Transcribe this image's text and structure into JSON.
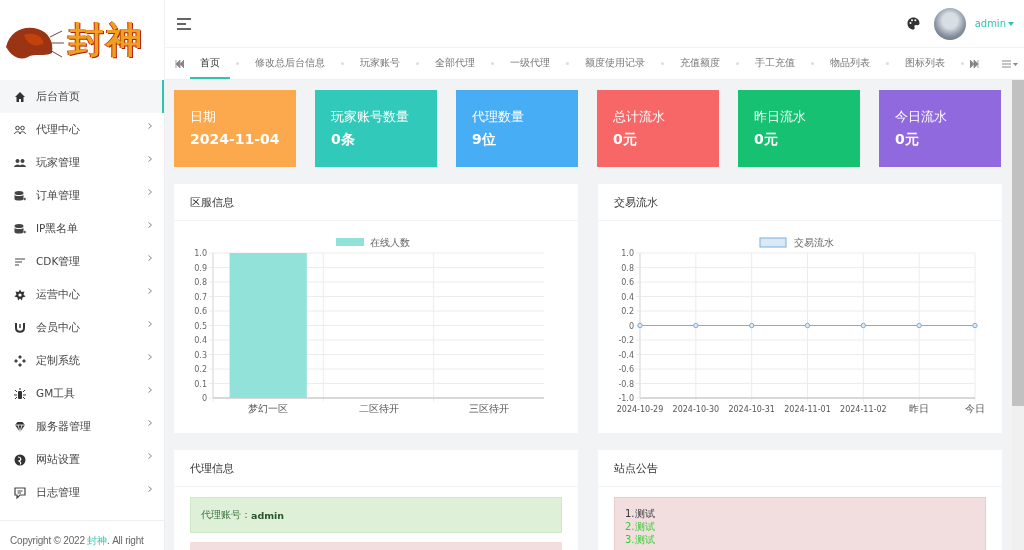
{
  "logo": {
    "text": "封神"
  },
  "sidebar": {
    "items": [
      {
        "label": "后台首页",
        "selected": true,
        "expandable": false
      },
      {
        "label": "代理中心",
        "selected": false,
        "expandable": true
      },
      {
        "label": "玩家管理",
        "selected": false,
        "expandable": true
      },
      {
        "label": "订单管理",
        "selected": false,
        "expandable": true
      },
      {
        "label": "IP黑名单",
        "selected": false,
        "expandable": true
      },
      {
        "label": "CDK管理",
        "selected": false,
        "expandable": true
      },
      {
        "label": "运营中心",
        "selected": false,
        "expandable": true
      },
      {
        "label": "会员中心",
        "selected": false,
        "expandable": true
      },
      {
        "label": "定制系统",
        "selected": false,
        "expandable": true
      },
      {
        "label": "GM工具",
        "selected": false,
        "expandable": true
      },
      {
        "label": "服务器管理",
        "selected": false,
        "expandable": true
      },
      {
        "label": "网站设置",
        "selected": false,
        "expandable": true
      },
      {
        "label": "日志管理",
        "selected": false,
        "expandable": true
      }
    ],
    "footer": {
      "before": "Copyright © 2022 ",
      "link": "封神",
      "after": ". All right"
    }
  },
  "header": {
    "user": "admin"
  },
  "tabs": [
    {
      "label": "首页",
      "selected": true
    },
    {
      "label": "修改总后台信息",
      "selected": false
    },
    {
      "label": "玩家账号",
      "selected": false
    },
    {
      "label": "全部代理",
      "selected": false
    },
    {
      "label": "一级代理",
      "selected": false
    },
    {
      "label": "额度使用记录",
      "selected": false
    },
    {
      "label": "充值额度",
      "selected": false
    },
    {
      "label": "手工充值",
      "selected": false
    },
    {
      "label": "物品列表",
      "selected": false
    },
    {
      "label": "图标列表",
      "selected": false
    }
  ],
  "stats": [
    {
      "label": "日期",
      "value": "2024-11-04",
      "color": "#fba94c"
    },
    {
      "label": "玩家账号数量",
      "value": "0条",
      "color": "#31c9b9"
    },
    {
      "label": "代理数量",
      "value": "9位",
      "color": "#47aef5"
    },
    {
      "label": "总计流水",
      "value": "0元",
      "color": "#f76767"
    },
    {
      "label": "昨日流水",
      "value": "0元",
      "color": "#16c172"
    },
    {
      "label": "今日流水",
      "value": "0元",
      "color": "#9169de"
    }
  ],
  "server_panel": {
    "title": "区服信息",
    "chart_data": {
      "type": "bar",
      "grid": true,
      "categories": [
        "梦幻一区",
        "二区待开",
        "三区待开"
      ],
      "series": [
        {
          "name": "在线人数",
          "color": "#93e2da",
          "values": [
            1,
            0,
            0
          ]
        }
      ],
      "ylim": [
        0,
        1
      ],
      "yticks": [
        0,
        0.1,
        0.2,
        0.3,
        0.4,
        0.5,
        0.6,
        0.7,
        0.8,
        0.9,
        {
          "value": 1,
          "label": "1.0"
        }
      ]
    }
  },
  "trade_panel": {
    "title": "交易流水",
    "chart_data": {
      "type": "line",
      "grid": true,
      "categories": [
        "2024-10-29",
        "2024-10-30",
        "2024-10-31",
        "2024-11-01",
        "2024-11-02",
        "昨日",
        "今日"
      ],
      "series": [
        {
          "name": "交易流水",
          "color": "#7aaedb",
          "marker": true,
          "values": [
            0,
            0,
            0,
            0,
            0,
            0,
            0
          ]
        }
      ],
      "ylim": [
        -1,
        1
      ],
      "yticks": [
        {
          "value": -1,
          "label": "-1.0"
        },
        -0.8,
        -0.6,
        -0.4,
        -0.2,
        0,
        0.2,
        0.4,
        0.6,
        0.8,
        {
          "value": 1,
          "label": "1.0"
        }
      ]
    }
  },
  "agent_panel": {
    "title": "代理信息",
    "account_label": "代理账号：",
    "account": "admin"
  },
  "notice_panel": {
    "title": "站点公告",
    "lines": [
      {
        "text": "1.测试",
        "color": "#333333"
      },
      {
        "text": "2.测试",
        "color": "#33cc33"
      },
      {
        "text": "3.测试",
        "color": "#33cc33"
      }
    ]
  }
}
